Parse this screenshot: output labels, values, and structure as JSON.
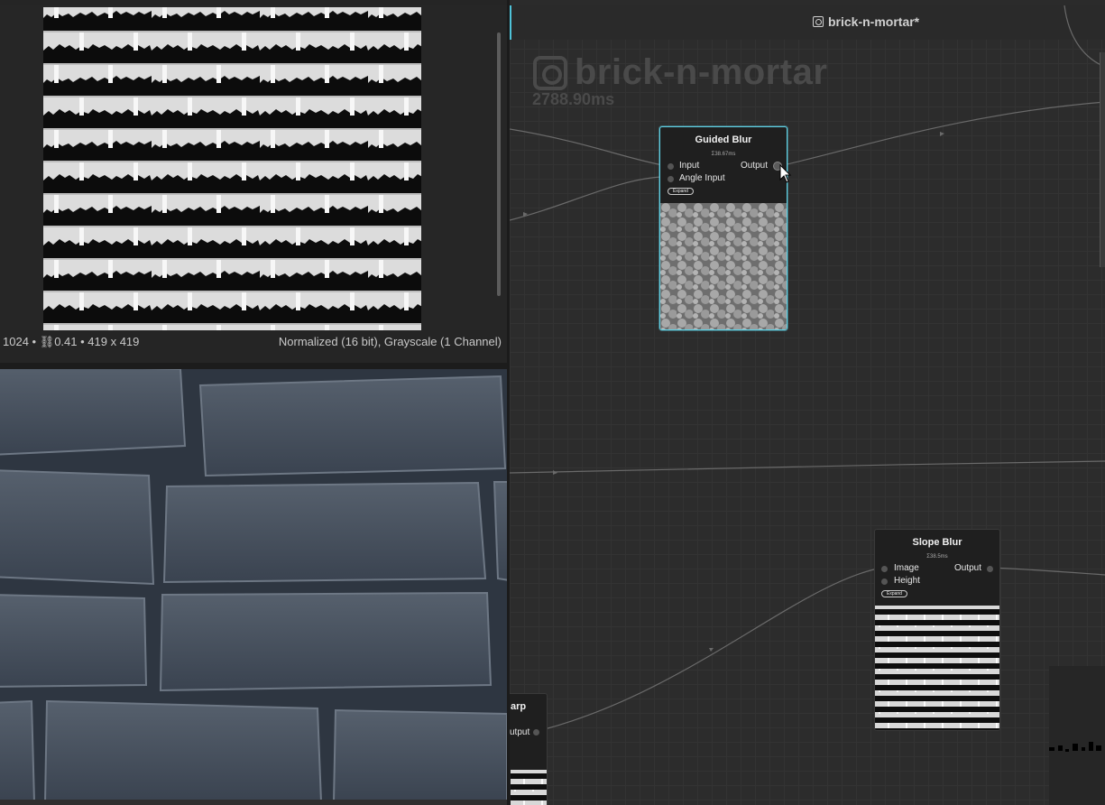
{
  "preview_info": {
    "left_text": "1024 • ⛓0.41 • 419 x 419",
    "right_text": "Normalized (16 bit), Grayscale (1 Channel)"
  },
  "graph": {
    "tab_title": "brick-n-mortar*",
    "watermark_title": "brick-n-mortar",
    "watermark_time": "2788.90ms"
  },
  "nodes": {
    "guided_blur": {
      "title": "Guided Blur",
      "time": "Σ38.67ms",
      "inputs": [
        "Input",
        "Angle Input"
      ],
      "output": "Output",
      "expand": "Expand"
    },
    "slope_blur": {
      "title": "Slope Blur",
      "time": "Σ38.5ms",
      "inputs": [
        "Image",
        "Height"
      ],
      "output": "Output",
      "expand": "Expand"
    },
    "warp_partial": {
      "title": "arp",
      "output": "utput"
    }
  },
  "colors": {
    "selection_accent": "#5fd0e3",
    "background": "#2c2c2c"
  }
}
